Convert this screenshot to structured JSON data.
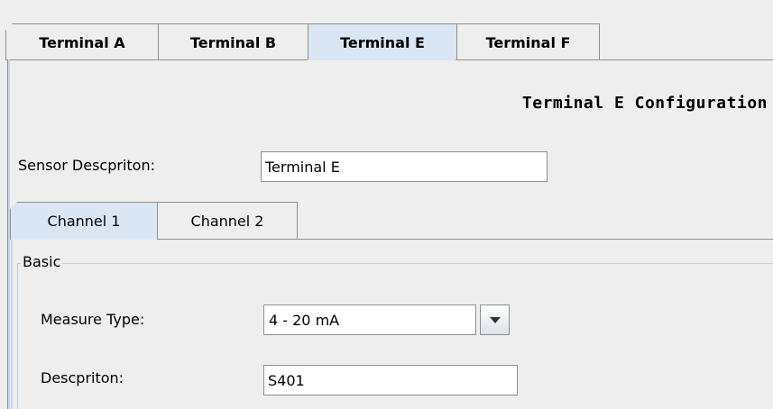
{
  "outer_tabs": [
    {
      "label": "Terminal A",
      "selected": false
    },
    {
      "label": "Terminal B",
      "selected": false
    },
    {
      "label": "Terminal E",
      "selected": true
    },
    {
      "label": "Terminal F",
      "selected": false
    }
  ],
  "config_title": "Terminal E Configuration",
  "sensor_description": {
    "label": "Sensor Descpriton:",
    "value": "Terminal E"
  },
  "inner_tabs": [
    {
      "label": "Channel 1",
      "selected": true
    },
    {
      "label": "Channel 2",
      "selected": false
    }
  ],
  "basic_group": {
    "title": "Basic",
    "measure_type": {
      "label": "Measure Type:",
      "value": "4 - 20 mA",
      "icon": "chevron-down-icon"
    },
    "description": {
      "label": "Descpriton:",
      "value": "S401"
    }
  },
  "colors": {
    "background": "#eeeeee",
    "selected_tab": "#dbe6f4",
    "border": "#8e8f8f",
    "group_border": "#b8cfe5"
  }
}
